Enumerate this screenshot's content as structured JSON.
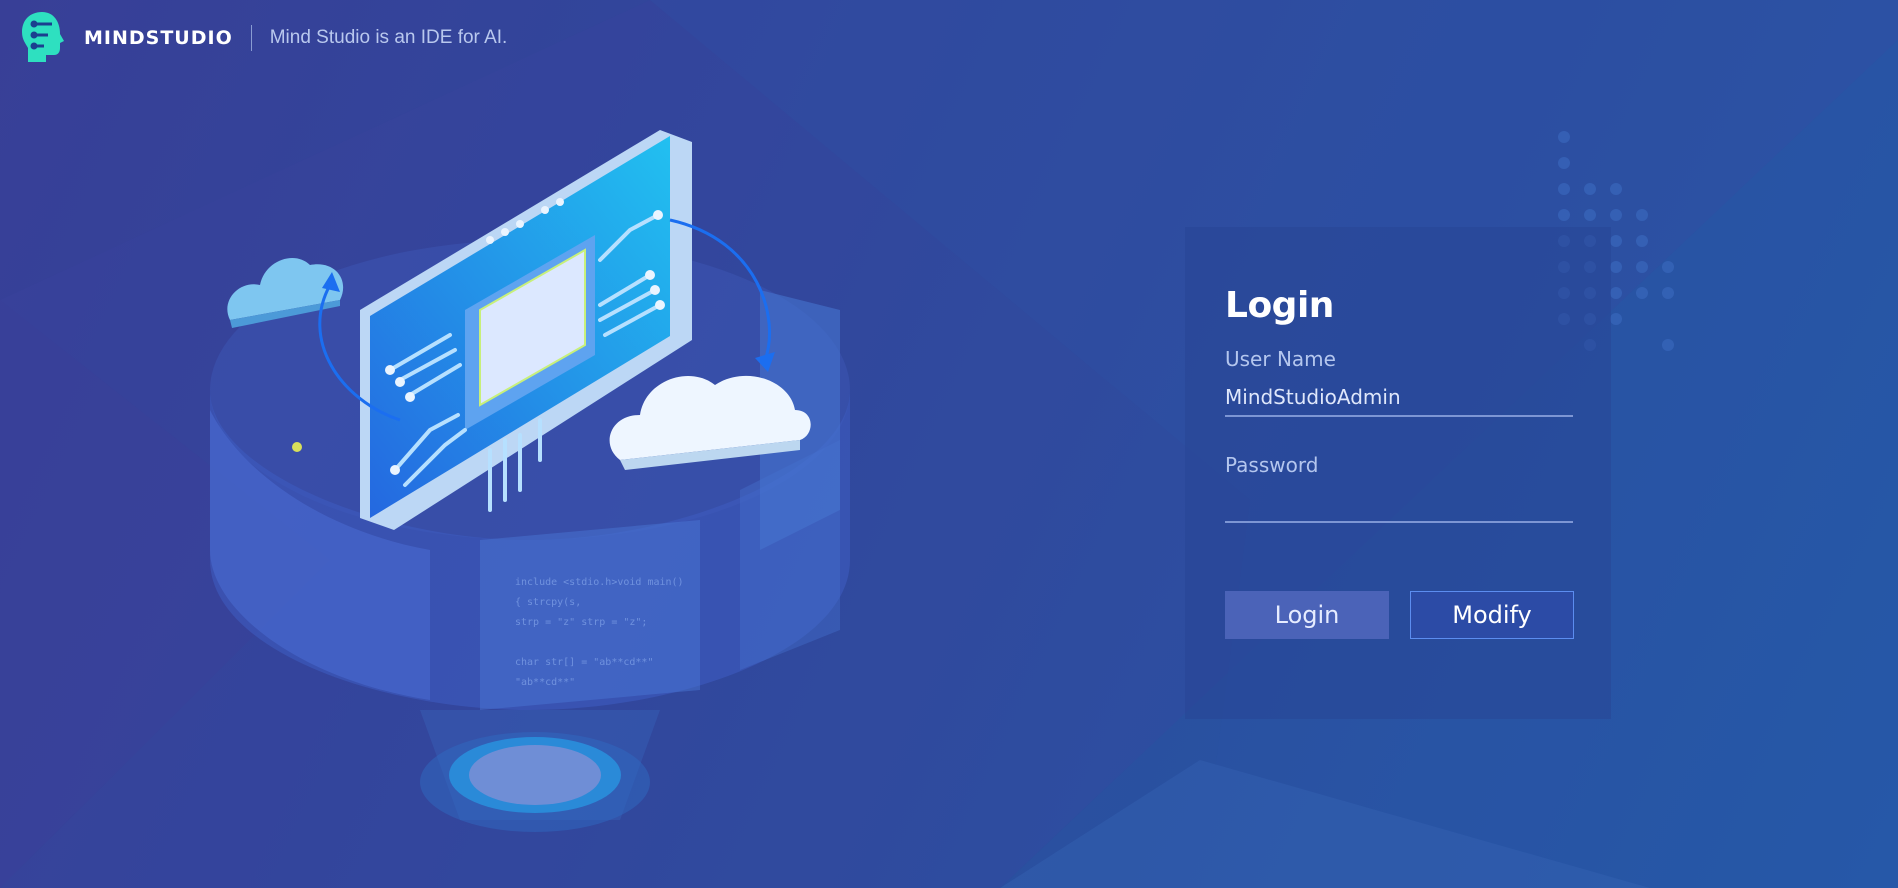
{
  "header": {
    "brand": "MINDSTUDIO",
    "tagline": "Mind Studio is an IDE for AI."
  },
  "login": {
    "title": "Login",
    "username_label": "User Name",
    "username_value": "MindStudioAdmin",
    "password_label": "Password",
    "password_value": "",
    "login_button": "Login",
    "modify_button": "Modify"
  },
  "illustration": {
    "code_lines": [
      "include <stdio.h>void main()",
      "{ strcpy(s,",
      "  strp = \"z\" strp = \"z\";",
      "",
      "char str[] = \"ab**cd**\"",
      "  \"ab**cd**\""
    ]
  },
  "colors": {
    "accent": "#5c8df0",
    "logo": "#2ee0c0",
    "panel": "#2846a0"
  }
}
